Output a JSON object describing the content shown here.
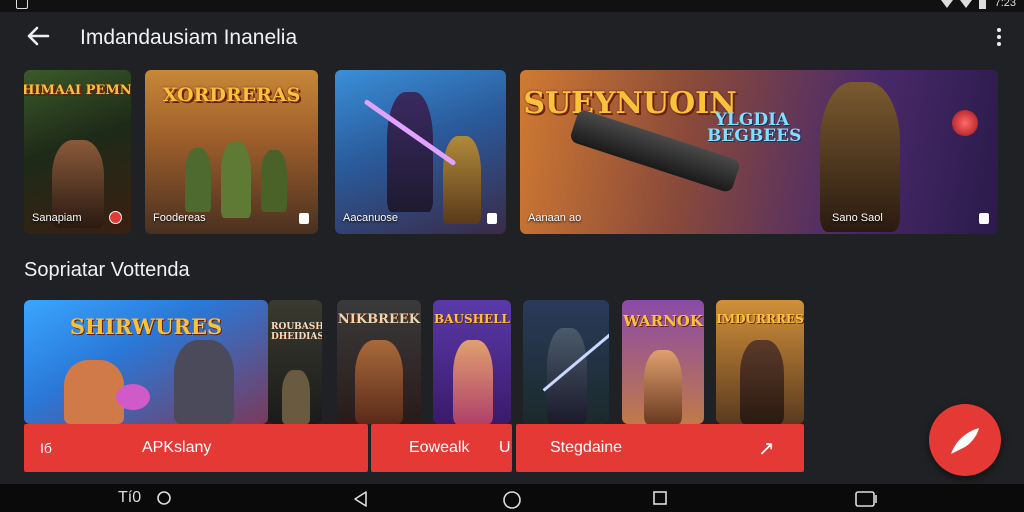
{
  "status_bar": {
    "time": "7:23"
  },
  "top_bar": {
    "title": "Imdandausiam Inanelia"
  },
  "featured": [
    {
      "art_title": "DSHIMAAI PEMNAN",
      "caption": "Sanapiam"
    },
    {
      "art_title": "XORDRERAS",
      "caption": "Foodereas"
    },
    {
      "art_title": "",
      "caption": "Aacanuose"
    },
    {
      "art_title": "SUEYNUOIN",
      "art_subtitle": "YLGDIA BEGBEES",
      "caption": "Aanaan ao",
      "caption2": "Sano Saol"
    }
  ],
  "section": {
    "title": "Sopriatar Vottenda"
  },
  "row": [
    {
      "art_title": "SHIRWURES"
    },
    {
      "art_title": "ROUBASH DHEIDIAS"
    },
    {
      "art_title": "NIKBREEK"
    },
    {
      "art_title": "BAUSHELL"
    },
    {
      "art_title": ""
    },
    {
      "art_title": "WARNOK"
    },
    {
      "art_title": "IMDURRRES"
    }
  ],
  "actions": {
    "left_icon": "Iб",
    "apk_label": "APKslany",
    "bowk_label": "Eowealk",
    "bowk_suffix": "U",
    "steg_label": "Stegdaine",
    "steg_arrow": "↗"
  },
  "nav": {
    "left_text": "Tí0"
  },
  "colors": {
    "accent": "#e53935",
    "background": "#202124",
    "game_title": "#f9c23c"
  }
}
